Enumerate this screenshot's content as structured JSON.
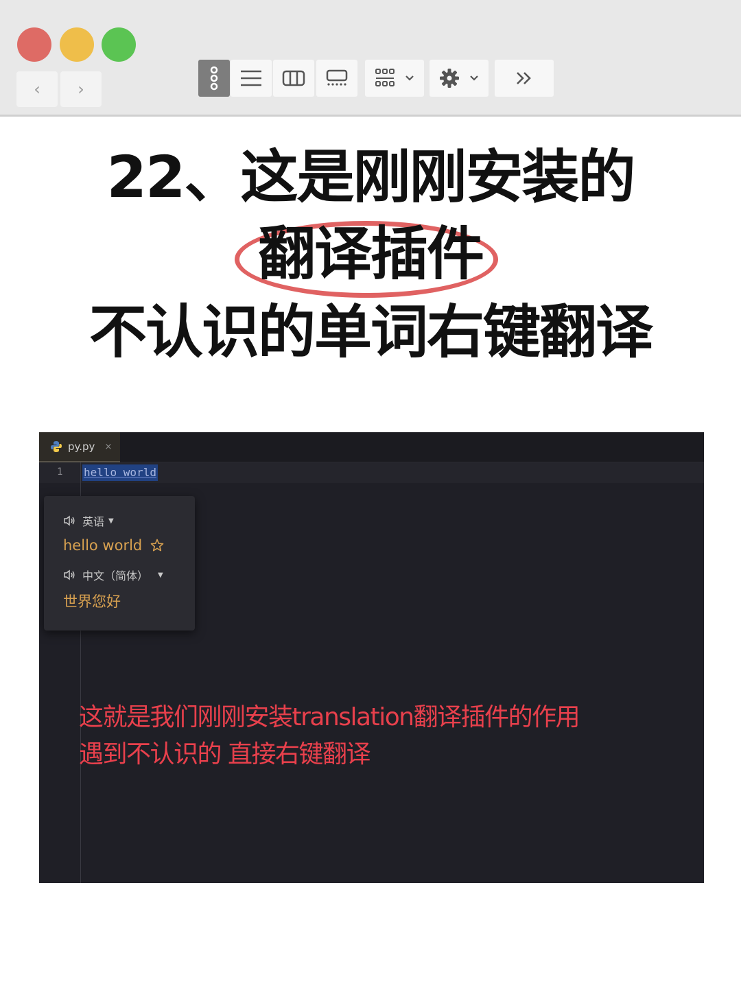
{
  "window": {
    "nav": {
      "back_icon": "chevron-left-icon",
      "forward_icon": "chevron-right-icon",
      "back_glyph": "‹",
      "forward_glyph": "›"
    },
    "toolbar": {
      "icons": [
        "vertical-dots-icon",
        "list-view-icon",
        "column-view-icon",
        "gallery-view-icon",
        "grid-group-icon",
        "gear-icon",
        "double-chevron-icon"
      ]
    },
    "colors": {
      "close": "#de6b65",
      "minimize": "#efbe4a",
      "zoom": "#5bc453"
    }
  },
  "headline": {
    "line1": "22、这是刚刚安装的",
    "line2": "翻译插件",
    "line3": "不认识的单词右键翻译",
    "highlight_color": "#e06262"
  },
  "editor": {
    "tab": {
      "label": "py.py",
      "close": "×"
    },
    "line_number": "1",
    "selected_code": "hello world",
    "popup": {
      "source_lang": "英语",
      "source_text": "hello world",
      "target_lang": "中文（简体）",
      "target_text": "世界您好",
      "accent": "#d8a150"
    },
    "annotation": {
      "line1": "这就是我们刚刚安装translation翻译插件的作用",
      "line2": "遇到不认识的 直接右键翻译",
      "color": "#e8404c"
    }
  }
}
